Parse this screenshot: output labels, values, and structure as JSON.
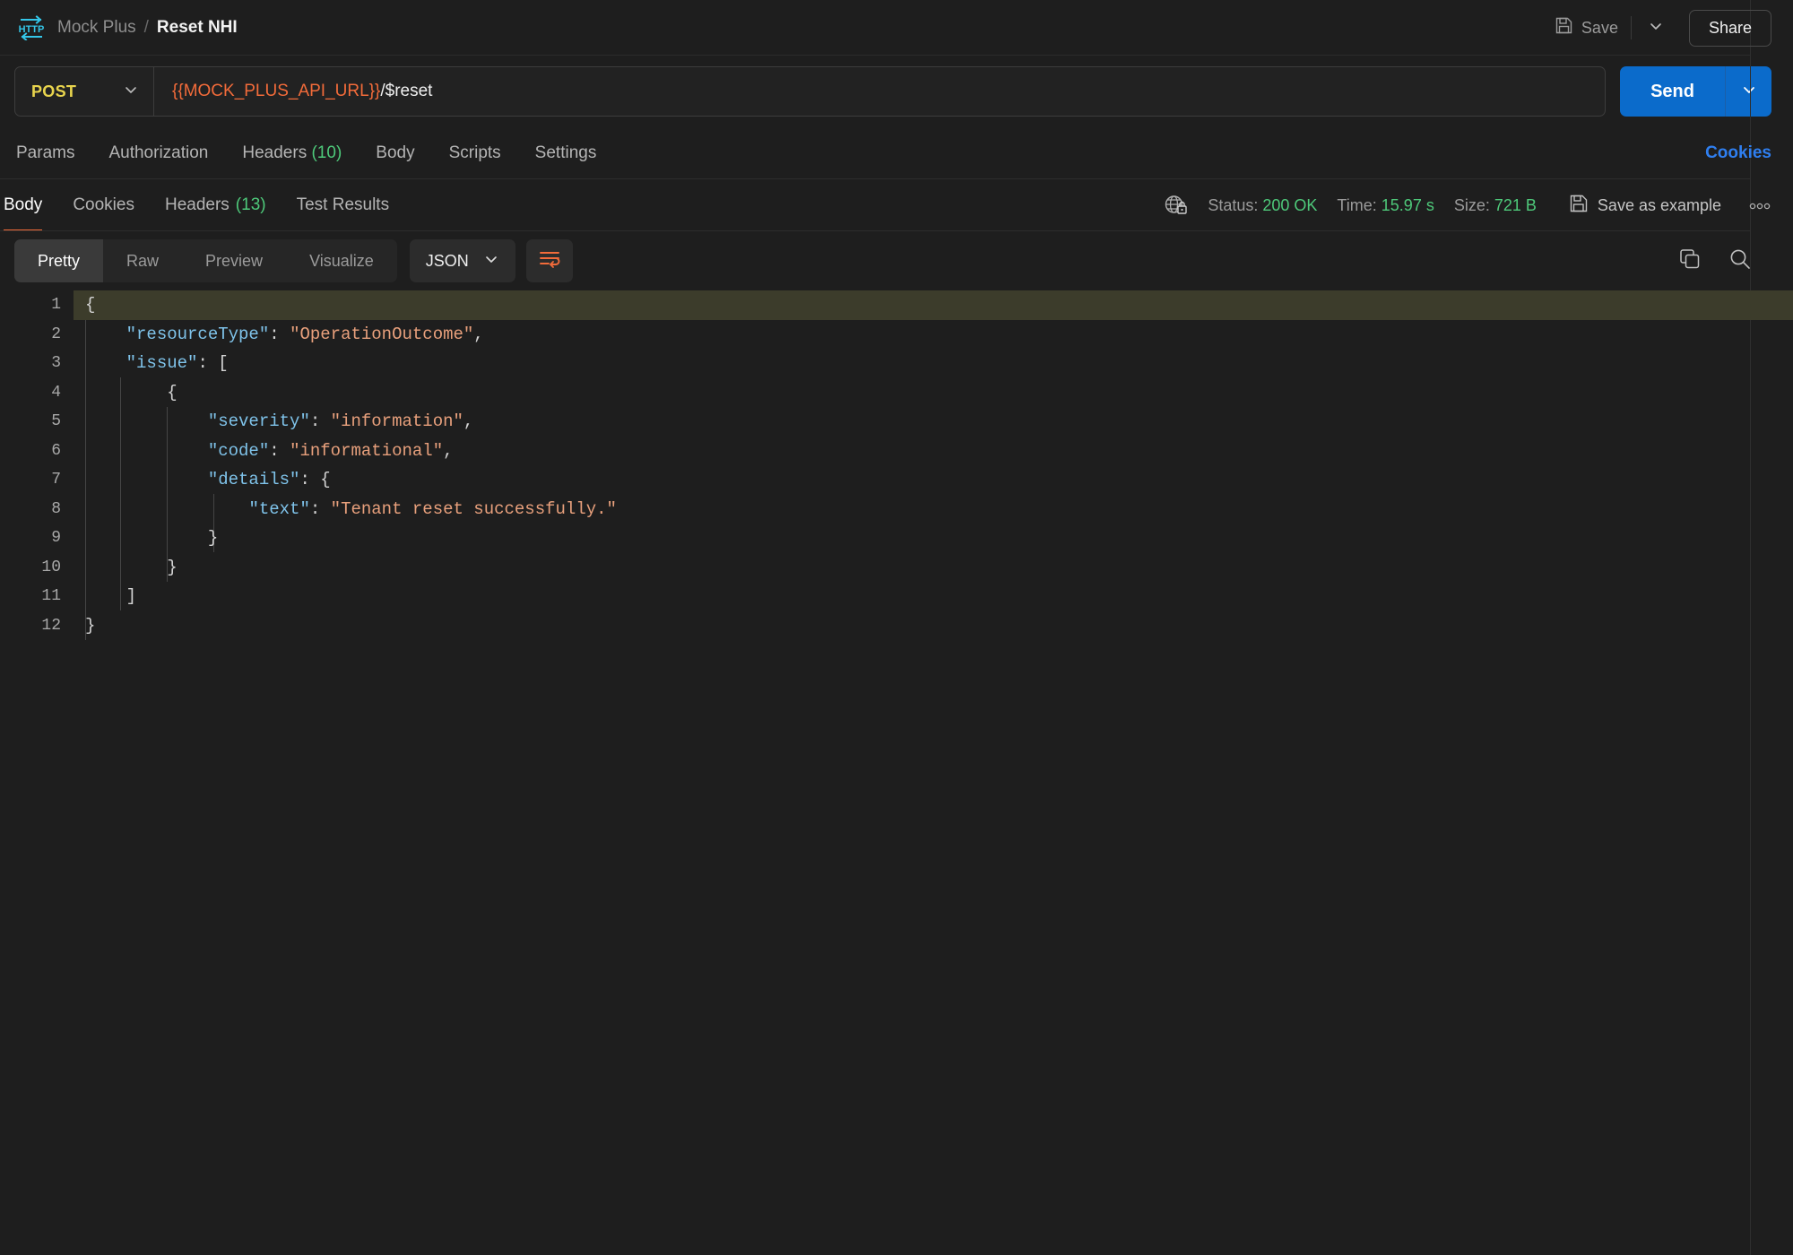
{
  "header": {
    "logo_icon": "http-icon",
    "breadcrumb": {
      "collection": "Mock Plus",
      "separator": "/",
      "current": "Reset NHI"
    },
    "save_label": "Save",
    "save_icon": "floppy-disk-icon",
    "save_caret_icon": "chevron-down-icon",
    "share_label": "Share"
  },
  "urlbar": {
    "method": "POST",
    "method_caret_icon": "chevron-down-icon",
    "url_variable": "{{MOCK_PLUS_API_URL}}",
    "url_path": "/$reset",
    "send_label": "Send",
    "send_caret_icon": "chevron-down-icon"
  },
  "request_tabs": {
    "items": [
      {
        "label": "Params",
        "count": ""
      },
      {
        "label": "Authorization",
        "count": ""
      },
      {
        "label": "Headers",
        "count": "(10)"
      },
      {
        "label": "Body",
        "count": ""
      },
      {
        "label": "Scripts",
        "count": ""
      },
      {
        "label": "Settings",
        "count": ""
      }
    ],
    "cookies_link": "Cookies"
  },
  "response": {
    "tabs": [
      {
        "label": "Body",
        "count": "",
        "active": true
      },
      {
        "label": "Cookies",
        "count": "",
        "active": false
      },
      {
        "label": "Headers",
        "count": "(13)",
        "active": false
      },
      {
        "label": "Test Results",
        "count": "",
        "active": false
      }
    ],
    "security_icon": "globe-lock-icon",
    "status_label": "Status:",
    "status_value": "200 OK",
    "time_label": "Time:",
    "time_value": "15.97 s",
    "size_label": "Size:",
    "size_value": "721 B",
    "save_example_label": "Save as example",
    "save_example_icon": "floppy-disk-icon",
    "more_icon": "more-horizontal-icon"
  },
  "format_bar": {
    "views": [
      "Pretty",
      "Raw",
      "Preview",
      "Visualize"
    ],
    "active_view": "Pretty",
    "language": "JSON",
    "language_caret_icon": "chevron-down-icon",
    "wrap_icon": "wrap-lines-icon",
    "copy_icon": "copy-icon",
    "search_icon": "search-icon"
  },
  "code": {
    "highlight_line": 1,
    "lines": [
      {
        "n": "1",
        "tokens": [
          {
            "t": "p",
            "v": "{"
          }
        ]
      },
      {
        "n": "2",
        "tokens": [
          {
            "t": "p",
            "v": "    "
          },
          {
            "t": "k",
            "v": "\"resourceType\""
          },
          {
            "t": "p",
            "v": ": "
          },
          {
            "t": "s",
            "v": "\"OperationOutcome\""
          },
          {
            "t": "p",
            "v": ","
          }
        ]
      },
      {
        "n": "3",
        "tokens": [
          {
            "t": "p",
            "v": "    "
          },
          {
            "t": "k",
            "v": "\"issue\""
          },
          {
            "t": "p",
            "v": ": ["
          }
        ]
      },
      {
        "n": "4",
        "tokens": [
          {
            "t": "p",
            "v": "        {"
          }
        ]
      },
      {
        "n": "5",
        "tokens": [
          {
            "t": "p",
            "v": "            "
          },
          {
            "t": "k",
            "v": "\"severity\""
          },
          {
            "t": "p",
            "v": ": "
          },
          {
            "t": "s",
            "v": "\"information\""
          },
          {
            "t": "p",
            "v": ","
          }
        ]
      },
      {
        "n": "6",
        "tokens": [
          {
            "t": "p",
            "v": "            "
          },
          {
            "t": "k",
            "v": "\"code\""
          },
          {
            "t": "p",
            "v": ": "
          },
          {
            "t": "s",
            "v": "\"informational\""
          },
          {
            "t": "p",
            "v": ","
          }
        ]
      },
      {
        "n": "7",
        "tokens": [
          {
            "t": "p",
            "v": "            "
          },
          {
            "t": "k",
            "v": "\"details\""
          },
          {
            "t": "p",
            "v": ": {"
          }
        ]
      },
      {
        "n": "8",
        "tokens": [
          {
            "t": "p",
            "v": "                "
          },
          {
            "t": "k",
            "v": "\"text\""
          },
          {
            "t": "p",
            "v": ": "
          },
          {
            "t": "s",
            "v": "\"Tenant reset successfully.\""
          }
        ]
      },
      {
        "n": "9",
        "tokens": [
          {
            "t": "p",
            "v": "            }"
          }
        ]
      },
      {
        "n": "10",
        "tokens": [
          {
            "t": "p",
            "v": "        }"
          }
        ]
      },
      {
        "n": "11",
        "tokens": [
          {
            "t": "p",
            "v": "    ]"
          }
        ]
      },
      {
        "n": "12",
        "tokens": [
          {
            "t": "p",
            "v": "}"
          }
        ]
      }
    ]
  },
  "colors": {
    "background": "#1e1e1e",
    "accent_orange": "#f26b3a",
    "accent_blue": "#0b6bcb",
    "link_blue": "#2f7ff0",
    "success_green": "#4ec97a",
    "method_yellow": "#e8d44d",
    "json_key": "#7fc3ea",
    "json_string": "#e8a07c",
    "highlight_line": "#3c3c2b"
  }
}
